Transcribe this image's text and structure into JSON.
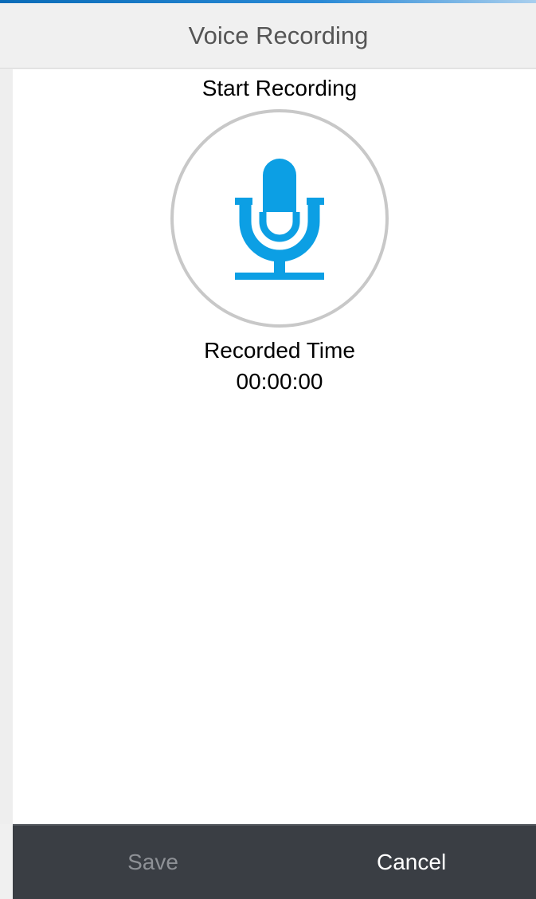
{
  "header": {
    "title": "Voice Recording"
  },
  "recorder": {
    "start_label": "Start Recording",
    "icon": "microphone-icon",
    "recorded_label": "Recorded Time",
    "recorded_time": "00:00:00"
  },
  "footer": {
    "save_label": "Save",
    "cancel_label": "Cancel"
  },
  "colors": {
    "accent": "#0c9fe4",
    "title_text": "#555555",
    "footer_bg": "#3a3e44",
    "save_disabled": "#8e9196",
    "cancel_text": "#ffffff",
    "ring": "#c8c8c8"
  }
}
